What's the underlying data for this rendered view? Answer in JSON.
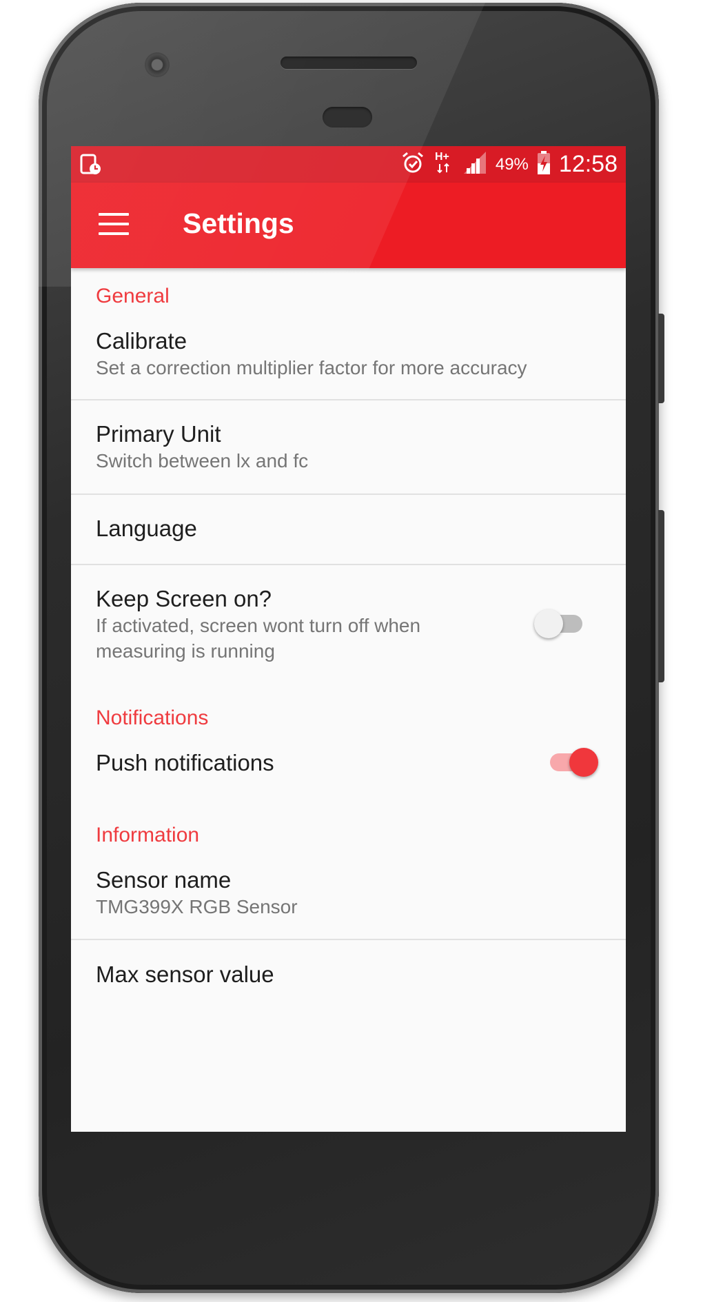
{
  "status_bar": {
    "left_icon": "screen-record-icon",
    "icons": [
      "alarm-icon",
      "network-hplus-icon",
      "signal-icon"
    ],
    "battery_percent": "49%",
    "battery_icon": "battery-charging-icon",
    "time": "12:58"
  },
  "app_bar": {
    "menu_icon": "hamburger-menu-icon",
    "title": "Settings",
    "color": "#ed1c24"
  },
  "sections": {
    "general": {
      "header": "General",
      "calibrate": {
        "title": "Calibrate",
        "summary": "Set a correction multiplier factor for more accuracy"
      },
      "primary_unit": {
        "title": "Primary Unit",
        "summary": "Switch between lx and fc"
      },
      "language": {
        "title": "Language"
      },
      "keep_screen_on": {
        "title": "Keep Screen on?",
        "summary": "If activated, screen wont turn off when measuring is running",
        "enabled": false
      }
    },
    "notifications": {
      "header": "Notifications",
      "push": {
        "title": "Push notifications",
        "enabled": true
      }
    },
    "information": {
      "header": "Information",
      "sensor_name": {
        "title": "Sensor name",
        "summary": "TMG399X RGB Sensor"
      },
      "max_sensor_value": {
        "title": "Max sensor value"
      }
    }
  },
  "colors": {
    "accent": "#ef3b3f",
    "status_bar": "#d81b25"
  }
}
